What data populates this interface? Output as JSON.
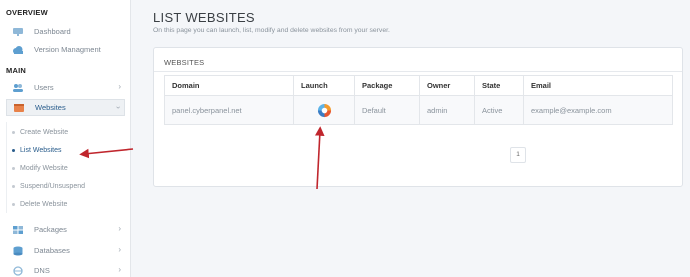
{
  "sidebar": {
    "overview_heading": "OVERVIEW",
    "main_heading": "MAIN",
    "overview_items": [
      {
        "label": "Dashboard",
        "icon": "monitor-icon"
      },
      {
        "label": "Version Managment",
        "icon": "cloud-icon"
      }
    ],
    "main_items": [
      {
        "label": "Users",
        "icon": "users-icon"
      },
      {
        "label": "Websites",
        "icon": "globe-icon"
      }
    ],
    "website_subitems": [
      {
        "label": "Create Website"
      },
      {
        "label": "List Websites"
      },
      {
        "label": "Modify Website"
      },
      {
        "label": "Suspend/Unsuspend"
      },
      {
        "label": "Delete Website"
      }
    ],
    "bottom_items": [
      {
        "label": "Packages",
        "icon": "packages-icon"
      },
      {
        "label": "Databases",
        "icon": "database-icon"
      },
      {
        "label": "DNS",
        "icon": "dns-icon"
      }
    ]
  },
  "page": {
    "title": "LIST WEBSITES",
    "subtitle": "On this page you can launch, list, modify and delete websites from your server."
  },
  "websites_card": {
    "title": "WEBSITES",
    "columns": [
      "Domain",
      "Launch",
      "Package",
      "Owner",
      "State",
      "Email"
    ],
    "rows": [
      {
        "domain": "panel.cyberpanel.net",
        "package": "Default",
        "owner": "admin",
        "state": "Active",
        "email": "example@example.com"
      }
    ],
    "page_number": "1"
  },
  "colors": {
    "accent": "#2a5d8c",
    "annotation_arrow": "#c0262d"
  }
}
